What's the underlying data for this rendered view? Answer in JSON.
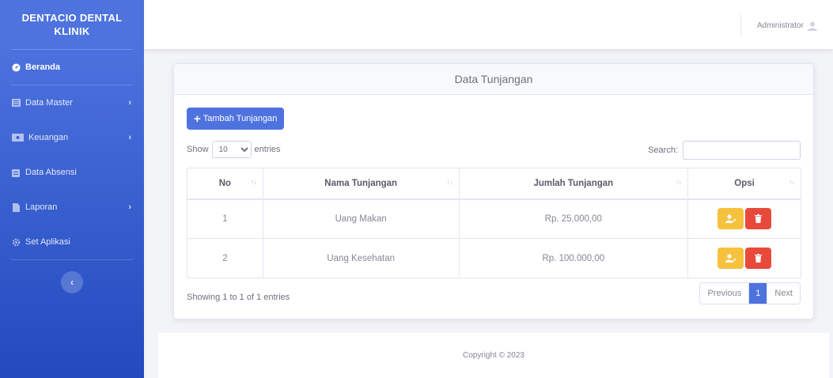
{
  "brand": {
    "line1": "DENTACIO DENTAL",
    "line2": "KLINIK"
  },
  "sidebar": {
    "items": [
      {
        "label": "Beranda",
        "icon": "dashboard-icon",
        "active": true,
        "has_chevron": false
      },
      {
        "label": "Data Master",
        "icon": "list-icon",
        "active": false,
        "has_chevron": true
      },
      {
        "label": "Keuangan",
        "icon": "money-icon",
        "active": false,
        "has_chevron": true
      },
      {
        "label": "Data Absensi",
        "icon": "calendar-icon",
        "active": false,
        "has_chevron": false
      },
      {
        "label": "Laporan",
        "icon": "file-icon",
        "active": false,
        "has_chevron": true
      },
      {
        "label": "Set Aplikasi",
        "icon": "gear-icon",
        "active": false,
        "has_chevron": false
      }
    ],
    "chevron": "›",
    "toggle_glyph": "‹"
  },
  "topbar": {
    "user_name": "Administrator",
    "user_icon": "user-icon"
  },
  "card": {
    "title": "Data Tunjangan",
    "add_button_icon": "+",
    "add_button_label": "Tambah Tunjangan",
    "show_label": "Show",
    "entries_label": "entries",
    "page_length": "10",
    "search_label": "Search:",
    "search_value": ""
  },
  "table": {
    "headers": [
      "No",
      "Nama Tunjangan",
      "Jumlah Tunjangan",
      "Opsi"
    ],
    "sort_glyph": "↑↓",
    "rows": [
      {
        "no": "1",
        "name": "Uang Makan",
        "amount": "Rp. 25.000,00"
      },
      {
        "no": "2",
        "name": "Uang Kesehatan",
        "amount": "Rp. 100.000,00"
      }
    ]
  },
  "footer_info": "Showing 1 to 1 of 1 entries",
  "pagination": {
    "previous": "Previous",
    "current": "1",
    "next": "Next"
  },
  "copyright": "Copyright © 2023",
  "colors": {
    "primary": "#4e73df",
    "warning": "#f6c23e",
    "danger": "#e74a3b"
  }
}
